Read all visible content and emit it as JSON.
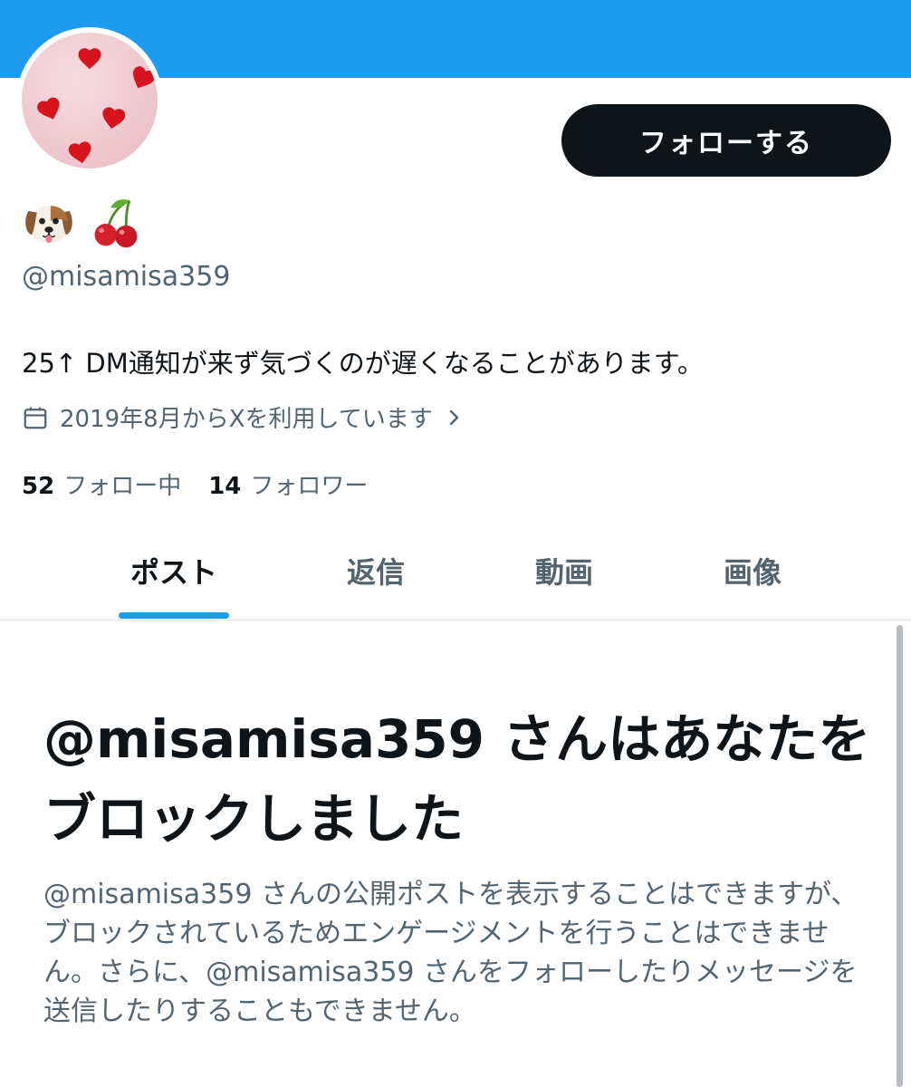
{
  "profile": {
    "follow_label": "フォローする",
    "handle": "@misamisa359",
    "bio": "25↑ DM通知が来ず気づくのが遅くなることがあります。",
    "joined": "2019年8月からXを利用しています",
    "following_count": "52",
    "following_label": "フォロー中",
    "followers_count": "14",
    "followers_label": "フォロワー",
    "display_name_icons": [
      "dog-face-icon",
      "cherries-icon"
    ]
  },
  "tabs": [
    {
      "label": "ポスト",
      "active": true
    },
    {
      "label": "返信",
      "active": false
    },
    {
      "label": "動画",
      "active": false
    },
    {
      "label": "画像",
      "active": false
    }
  ],
  "blocked": {
    "title": "@misamisa359 さんはあなたをブロックしました",
    "description": "@misamisa359 さんの公開ポストを表示することはできますが、ブロックされているためエンゲージメントを行うことはできません。さらに、@misamisa359 さんをフォローしたりメッセージを送信したりすることもできません。"
  },
  "colors": {
    "accent": "#1d9bf0",
    "text_primary": "#0f1419",
    "text_secondary": "#536471",
    "button_bg": "#0f1419"
  }
}
